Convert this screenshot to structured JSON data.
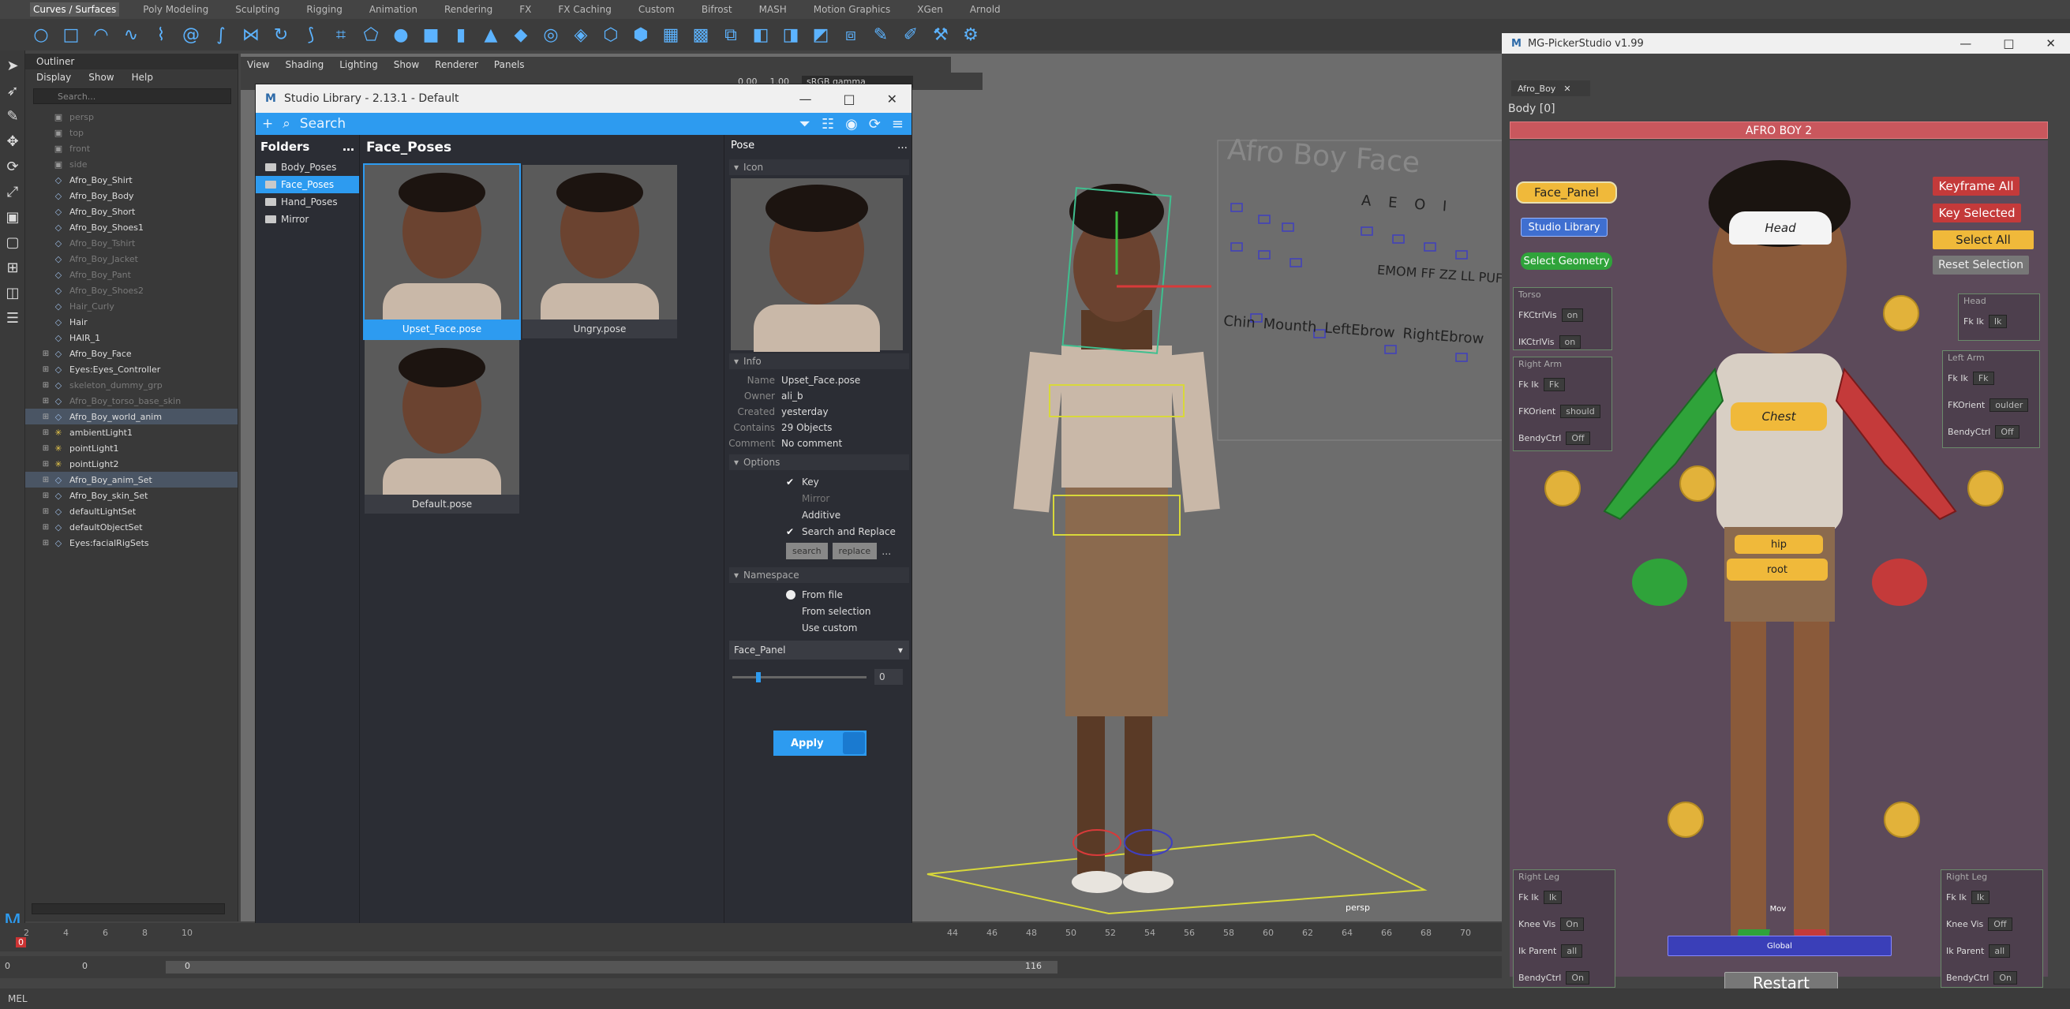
{
  "shelf_tabs": [
    "Curves / Surfaces",
    "Poly Modeling",
    "Sculpting",
    "Rigging",
    "Animation",
    "Rendering",
    "FX",
    "FX Caching",
    "Custom",
    "Bifrost",
    "MASH",
    "Motion Graphics",
    "XGen",
    "Arnold"
  ],
  "outliner": {
    "title": "Outliner",
    "menu": [
      "Display",
      "Show",
      "Help"
    ],
    "search_placeholder": "Search...",
    "items": [
      {
        "label": "persp",
        "dim": true
      },
      {
        "label": "top",
        "dim": true
      },
      {
        "label": "front",
        "dim": true
      },
      {
        "label": "side",
        "dim": true
      },
      {
        "label": "Afro_Boy_Shirt"
      },
      {
        "label": "Afro_Boy_Body"
      },
      {
        "label": "Afro_Boy_Short"
      },
      {
        "label": "Afro_Boy_Shoes1"
      },
      {
        "label": "Afro_Boy_Tshirt",
        "dim": true
      },
      {
        "label": "Afro_Boy_Jacket",
        "dim": true
      },
      {
        "label": "Afro_Boy_Pant",
        "dim": true
      },
      {
        "label": "Afro_Boy_Shoes2",
        "dim": true
      },
      {
        "label": "Hair_Curly",
        "dim": true
      },
      {
        "label": "Hair"
      },
      {
        "label": "HAIR_1"
      },
      {
        "label": "Afro_Boy_Face"
      },
      {
        "label": "Eyes:Eyes_Controller"
      },
      {
        "label": "skeleton_dummy_grp",
        "dim": true
      },
      {
        "label": "Afro_Boy_torso_base_skin",
        "dim": true
      },
      {
        "label": "Afro_Boy_world_anim",
        "sel": true
      },
      {
        "label": "ambientLight1"
      },
      {
        "label": "pointLight1"
      },
      {
        "label": "pointLight2"
      },
      {
        "label": "Afro_Boy_anim_Set",
        "sel": true
      },
      {
        "label": "Afro_Boy_skin_Set"
      },
      {
        "label": "defaultLightSet"
      },
      {
        "label": "defaultObjectSet"
      },
      {
        "label": "Eyes:facialRigSets"
      }
    ]
  },
  "viewport": {
    "menu": [
      "View",
      "Shading",
      "Lighting",
      "Show",
      "Renderer",
      "Panels"
    ],
    "exposure": "0.00",
    "gamma": "1.00",
    "colorspace": "sRGB gamma",
    "camera": "persp",
    "board_title": "Afro Boy Face",
    "board_labels": [
      "Chin",
      "Mounth",
      "LeftEbrow",
      "RightEbrow"
    ],
    "board_phonemes": "A E O I",
    "board_phonemes2": "EMOM FF ZZ LL PUF"
  },
  "studio_library": {
    "title": "Studio Library - 2.13.1 - Default",
    "search_placeholder": "Search",
    "folders_header": "Folders",
    "folders": [
      {
        "label": "Body_Poses"
      },
      {
        "label": "Face_Poses",
        "sel": true
      },
      {
        "label": "Hand_Poses"
      },
      {
        "label": "Mirror"
      }
    ],
    "items_header": "Face_Poses",
    "items": [
      {
        "label": "Upset_Face.pose",
        "sel": true
      },
      {
        "label": "Ungry.pose"
      },
      {
        "label": "Default.pose"
      }
    ],
    "pose_header": "Pose",
    "icon_section": "Icon",
    "info_section": "Info",
    "info": [
      {
        "k": "Name",
        "v": "Upset_Face.pose"
      },
      {
        "k": "Owner",
        "v": "ali_b"
      },
      {
        "k": "Created",
        "v": "yesterday"
      },
      {
        "k": "Contains",
        "v": "29 Objects"
      },
      {
        "k": "Comment",
        "v": "No comment"
      }
    ],
    "options_section": "Options",
    "options": [
      {
        "label": "Key",
        "checked": true
      },
      {
        "label": "Mirror",
        "dim": true
      },
      {
        "label": "Additive"
      },
      {
        "label": "Search and Replace",
        "checked": true
      }
    ],
    "search_btn": "search",
    "replace_btn": "replace",
    "namespace_section": "Namespace",
    "namespace": [
      "From file",
      "From selection",
      "Use custom"
    ],
    "namespace_value": "Face_Panel",
    "slider_value": "0",
    "apply": "Apply"
  },
  "picker": {
    "title": "MG-PickerStudio v1.99",
    "tab": "Afro_Boy",
    "body_label": "Body [0]",
    "banner": "AFRO BOY 2",
    "buttons": {
      "face_panel": "Face_Panel",
      "studio_library": "Studio Library",
      "select_geometry": "Select Geometry",
      "keyframe_all": "Keyframe All",
      "key_selected": "Key Selected",
      "select_all": "Select All",
      "reset_selection": "Reset Selection",
      "restart": "Restart"
    },
    "body_parts": {
      "head": "Head",
      "chest": "Chest",
      "hip": "hip",
      "root": "root",
      "mov": "Mov",
      "global": "Global"
    },
    "torso": {
      "title": "Torso",
      "rows": [
        {
          "k": "FKCtrlVis",
          "v": "on"
        },
        {
          "k": "IKCtrlVis",
          "v": "on"
        }
      ]
    },
    "head": {
      "title": "Head",
      "rows": [
        {
          "k": "Fk Ik",
          "v": "Ik"
        }
      ]
    },
    "right_arm": {
      "title": "Right Arm",
      "rows": [
        {
          "k": "Fk Ik",
          "v": "Fk"
        },
        {
          "k": "FKOrient",
          "v": "should"
        },
        {
          "k": "BendyCtrl",
          "v": "Off"
        }
      ]
    },
    "left_arm": {
      "title": "Left Arm",
      "rows": [
        {
          "k": "Fk Ik",
          "v": "Fk"
        },
        {
          "k": "FKOrient",
          "v": "oulder"
        },
        {
          "k": "BendyCtrl",
          "v": "Off"
        }
      ]
    },
    "right_leg": {
      "title": "Right Leg",
      "rows": [
        {
          "k": "Fk Ik",
          "v": "Ik"
        },
        {
          "k": "Knee Vis",
          "v": "On"
        },
        {
          "k": "Ik Parent",
          "v": "all"
        },
        {
          "k": "BendyCtrl",
          "v": "On"
        }
      ]
    },
    "left_leg": {
      "title": "Right Leg",
      "rows": [
        {
          "k": "Fk Ik",
          "v": "Ik"
        },
        {
          "k": "Knee Vis",
          "v": "Off"
        },
        {
          "k": "Ik Parent",
          "v": "all"
        },
        {
          "k": "BendyCtrl",
          "v": "On"
        }
      ]
    },
    "colors": {
      "banner": "#c9575d",
      "yellow": "#f0b93a",
      "blue": "#3f6fd0",
      "green": "#2fa33a",
      "red": "#c43a3a"
    }
  },
  "timeline": {
    "ticks": [
      "2",
      "4",
      "6",
      "8",
      "10",
      "44",
      "46",
      "48",
      "50",
      "52",
      "54",
      "56",
      "58",
      "60",
      "62",
      "64",
      "66",
      "68",
      "70"
    ],
    "current": "0",
    "start": "0",
    "start2": "0",
    "range_start": "0",
    "range_end": "116"
  },
  "command_line": "MEL"
}
